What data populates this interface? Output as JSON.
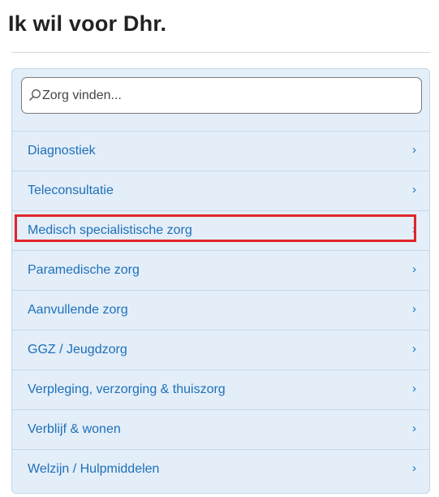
{
  "header": {
    "title": "Ik wil voor Dhr."
  },
  "search": {
    "placeholder": "Zorg vinden...",
    "value": "",
    "icon": "search-icon"
  },
  "menu": {
    "items": [
      {
        "label": "Diagnostiek",
        "chevron": "›"
      },
      {
        "label": "Teleconsultatie",
        "chevron": "›"
      },
      {
        "label": "Medisch specialistische zorg",
        "chevron": "›"
      },
      {
        "label": "Paramedische zorg",
        "chevron": "›"
      },
      {
        "label": "Aanvullende zorg",
        "chevron": "›"
      },
      {
        "label": "GGZ / Jeugdzorg",
        "chevron": "›"
      },
      {
        "label": "Verpleging, verzorging & thuiszorg",
        "chevron": "›"
      },
      {
        "label": "Verblijf & wonen",
        "chevron": "›"
      },
      {
        "label": "Welzijn / Hulpmiddelen",
        "chevron": "›"
      }
    ]
  },
  "colors": {
    "link": "#1f6fb8",
    "panel_background": "#e3eef9",
    "highlight_border": "#e0262a"
  }
}
